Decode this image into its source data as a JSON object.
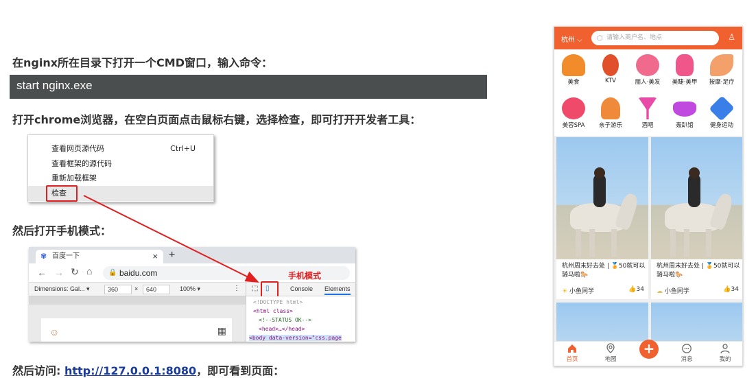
{
  "doc": {
    "step1": "在nginx所在目录下打开一个CMD窗口，输入命令：",
    "command": "start nginx.exe",
    "step2": "打开chrome浏览器，在空白页面点击鼠标右键，选择检查，即可打开开发者工具：",
    "step3": "然后打开手机模式：",
    "step4_prefix": "然后访问: ",
    "step4_link": "http://127.0.0.1:8080",
    "step4_suffix": "，即可看到页面："
  },
  "context_menu": {
    "items": [
      {
        "label": "查看网页源代码",
        "shortcut": "Ctrl+U"
      },
      {
        "label": "查看框架的源代码",
        "shortcut": ""
      },
      {
        "label": "重新加载框架",
        "shortcut": ""
      },
      {
        "label": "检查",
        "shortcut": ""
      }
    ]
  },
  "browser": {
    "tab_title": "百度一下",
    "tab_close": "×",
    "new_tab": "+",
    "url": "baidu.com",
    "device": "Dimensions: Gal...",
    "width": "360",
    "times": "×",
    "height": "640",
    "zoom": "100%",
    "panel_tabs": [
      "Console",
      "Elements"
    ],
    "code_lines": [
      "<!DOCTYPE html>",
      "<html class>",
      "<!--STATUS OK-->",
      "<head>…</head>",
      "<body data-version=\"css.page"
    ],
    "annotation": "手机模式"
  },
  "phone": {
    "city": "杭州",
    "search_placeholder": "请输入商户名、地点",
    "categories": [
      {
        "label": "美食",
        "color": "#f28c2a"
      },
      {
        "label": "KTV",
        "color": "#e0502a"
      },
      {
        "label": "丽人·美发",
        "color": "#f06a8e"
      },
      {
        "label": "美睫·美甲",
        "color": "#f0568a"
      },
      {
        "label": "按摩·足疗",
        "color": "#f3a06a"
      },
      {
        "label": "美容SPA",
        "color": "#f04a6a"
      },
      {
        "label": "亲子游乐",
        "color": "#ef8a3a"
      },
      {
        "label": "酒吧",
        "color": "#e84aa8"
      },
      {
        "label": "轰趴馆",
        "color": "#c04ae0"
      },
      {
        "label": "健身运动",
        "color": "#3a7ee8"
      }
    ],
    "cards": [
      {
        "title": "杭州周末好去处 | 🏅50就可以骑马啦🐎",
        "user": "小鱼同学",
        "likes": "34"
      },
      {
        "title": "杭州周末好去处 | 🏅50就可以骑马啦🐎",
        "user": "小鱼同学",
        "likes": "34"
      }
    ],
    "nav": [
      {
        "label": "首页",
        "icon": "home-icon"
      },
      {
        "label": "地图",
        "icon": "map-icon"
      },
      {
        "label": "",
        "icon": "plus-icon"
      },
      {
        "label": "消息",
        "icon": "message-icon"
      },
      {
        "label": "我的",
        "icon": "user-icon"
      }
    ],
    "accent": "#f0612f"
  }
}
